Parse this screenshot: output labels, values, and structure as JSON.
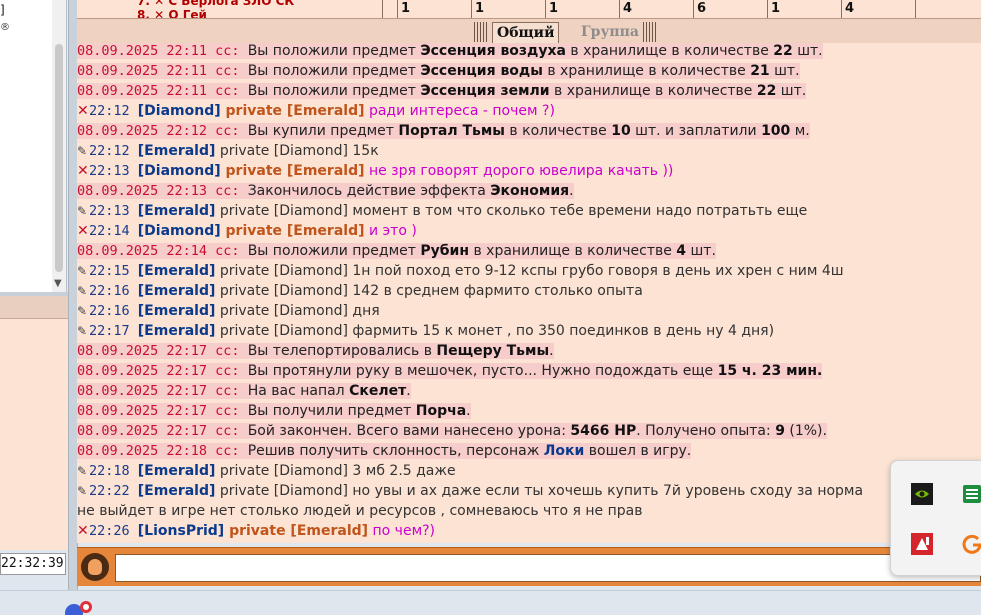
{
  "left_panel": {
    "top_text": "]",
    "registered_mark": "®",
    "clock": "22:32:39"
  },
  "top_strip": {
    "line1": "7. ✕ С Берлога ЗЛО СК",
    "line2": "8. ✕ Ο Гей",
    "numbers": [
      "1",
      "1",
      "1",
      "4",
      "6",
      "1",
      "4"
    ]
  },
  "tabs": [
    {
      "label": "Общий",
      "active": true
    },
    {
      "label": "Группа",
      "active": false
    }
  ],
  "chat": [
    {
      "kind": "sys",
      "ts": "08.09.2025 22:11",
      "parts": [
        {
          "t": "Вы положили предмет "
        },
        {
          "t": "Эссенция воздуха",
          "b": true
        },
        {
          "t": " в хранилище в количестве "
        },
        {
          "t": "22",
          "b": true
        },
        {
          "t": " шт."
        }
      ]
    },
    {
      "kind": "sys",
      "ts": "08.09.2025 22:11",
      "parts": [
        {
          "t": "Вы положили предмет "
        },
        {
          "t": "Эссенция воды",
          "b": true
        },
        {
          "t": " в хранилище в количестве "
        },
        {
          "t": "21",
          "b": true
        },
        {
          "t": " шт."
        }
      ]
    },
    {
      "kind": "sys",
      "ts": "08.09.2025 22:11",
      "parts": [
        {
          "t": "Вы положили предмет "
        },
        {
          "t": "Эссенция земли",
          "b": true
        },
        {
          "t": " в хранилище в количестве "
        },
        {
          "t": "22",
          "b": true
        },
        {
          "t": " шт."
        }
      ]
    },
    {
      "kind": "out",
      "ts": "22:12",
      "from": "Diamond",
      "to": "Emerald",
      "msg": "ради интереса - почем ?)"
    },
    {
      "kind": "sys",
      "ts": "08.09.2025 22:12",
      "parts": [
        {
          "t": "Вы купили предмет "
        },
        {
          "t": "Портал Тьмы",
          "b": true
        },
        {
          "t": " в количестве "
        },
        {
          "t": "10",
          "b": true
        },
        {
          "t": " шт. и заплатили "
        },
        {
          "t": "100",
          "b": true
        },
        {
          "t": " м."
        }
      ]
    },
    {
      "kind": "in",
      "ts": "22:12",
      "from": "Emerald",
      "to": "Diamond",
      "msg": "15к"
    },
    {
      "kind": "out",
      "ts": "22:13",
      "from": "Diamond",
      "to": "Emerald",
      "msg": "не зря говорят дорого ювелира качать ))"
    },
    {
      "kind": "sys",
      "ts": "08.09.2025 22:13",
      "parts": [
        {
          "t": "Закончилось действие эффекта "
        },
        {
          "t": "Экономия",
          "b": true
        },
        {
          "t": "."
        }
      ]
    },
    {
      "kind": "in",
      "ts": "22:13",
      "from": "Emerald",
      "to": "Diamond",
      "msg": "момент в том что сколько тебе времени надо потратьть еще"
    },
    {
      "kind": "out",
      "ts": "22:14",
      "from": "Diamond",
      "to": "Emerald",
      "msg": "и это )"
    },
    {
      "kind": "sys",
      "ts": "08.09.2025 22:14",
      "parts": [
        {
          "t": "Вы положили предмет "
        },
        {
          "t": "Рубин",
          "b": true
        },
        {
          "t": " в хранилище в количестве "
        },
        {
          "t": "4",
          "b": true
        },
        {
          "t": " шт."
        }
      ]
    },
    {
      "kind": "in",
      "ts": "22:15",
      "from": "Emerald",
      "to": "Diamond",
      "msg": "1н пой поход ето 9-12 кспы грубо говоря в день их хрен с ним 4ш"
    },
    {
      "kind": "in",
      "ts": "22:16",
      "from": "Emerald",
      "to": "Diamond",
      "msg": "142 в среднем фармито столько опыта"
    },
    {
      "kind": "in",
      "ts": "22:16",
      "from": "Emerald",
      "to": "Diamond",
      "msg": "дня"
    },
    {
      "kind": "in",
      "ts": "22:17",
      "from": "Emerald",
      "to": "Diamond",
      "msg": "фармить 15 к монет , по 350 поединков в день ну 4 дня)"
    },
    {
      "kind": "sys",
      "ts": "08.09.2025 22:17",
      "parts": [
        {
          "t": "Вы телепортировались в "
        },
        {
          "t": "Пещеру Тьмы",
          "b": true
        },
        {
          "t": "."
        }
      ]
    },
    {
      "kind": "sys",
      "ts": "08.09.2025 22:17",
      "parts": [
        {
          "t": "Вы протянули руку в мешочек, пусто... Нужно подождать еще "
        },
        {
          "t": "15 ч. 23 мин.",
          "b": true
        }
      ]
    },
    {
      "kind": "sys",
      "ts": "08.09.2025 22:17",
      "parts": [
        {
          "t": "На вас напал "
        },
        {
          "t": "Скелет",
          "b": true
        },
        {
          "t": "."
        }
      ]
    },
    {
      "kind": "sys",
      "ts": "08.09.2025 22:17",
      "parts": [
        {
          "t": "Вы получили предмет "
        },
        {
          "t": "Порча",
          "b": true
        },
        {
          "t": "."
        }
      ]
    },
    {
      "kind": "sys",
      "ts": "08.09.2025 22:17",
      "parts": [
        {
          "t": "Бой закончен. Всего вами нанесено урона: "
        },
        {
          "t": "5466 HP",
          "b": true
        },
        {
          "t": ". Получено опыта: "
        },
        {
          "t": "9",
          "b": true
        },
        {
          "t": " (1%)."
        }
      ]
    },
    {
      "kind": "sys",
      "ts": "08.09.2025 22:18",
      "parts": [
        {
          "t": "Решив получить склонность, персонаж "
        },
        {
          "t": "Локи",
          "loki": true
        },
        {
          "t": " вошел в игру."
        }
      ]
    },
    {
      "kind": "in",
      "ts": "22:18",
      "from": "Emerald",
      "to": "Diamond",
      "msg": "3 мб 2.5 даже"
    },
    {
      "kind": "in",
      "ts": "22:22",
      "from": "Emerald",
      "to": "Diamond",
      "msg": "но увы и ах даже если ты хочешь купить 7й уровень сходу за норма"
    },
    {
      "kind": "cont",
      "msg": "не выйдет в игре нет столько людей и ресурсов , сомневаюсь что я не прав"
    },
    {
      "kind": "out",
      "ts": "22:26",
      "from": "LionsPrid",
      "to": "Emerald",
      "msg": "по чем?)"
    }
  ],
  "labels": {
    "sys_tag": "cc:",
    "private": "private"
  },
  "input": {
    "value": "",
    "placeholder": ""
  },
  "tray": [
    "nvidia-icon",
    "sheets-icon",
    "amd-icon",
    "g-icon"
  ]
}
